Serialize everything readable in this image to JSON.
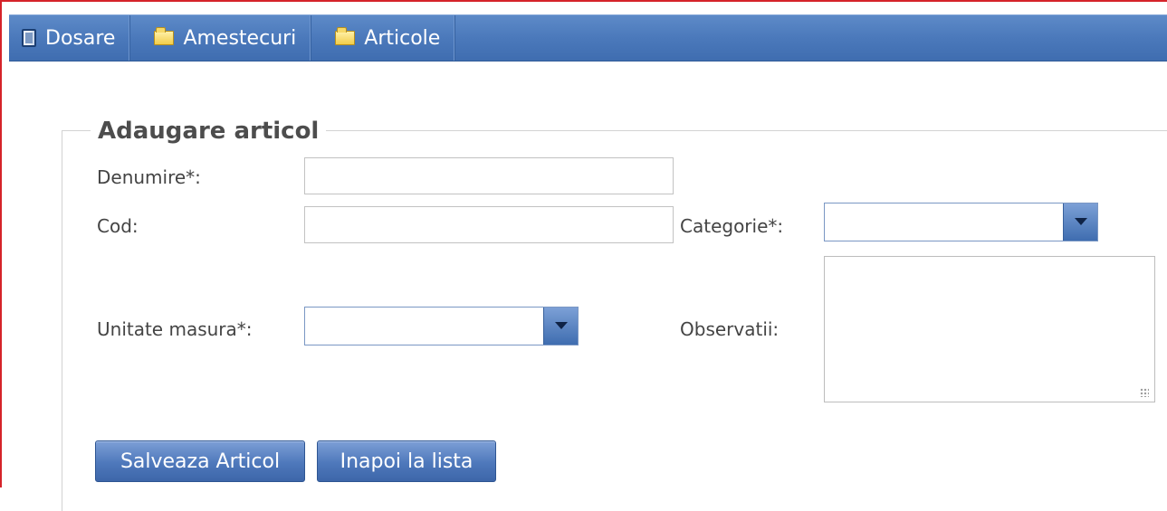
{
  "toolbar": {
    "items": [
      {
        "label": "Dosare",
        "icon": "book-icon"
      },
      {
        "label": "Amestecuri",
        "icon": "folder-icon"
      },
      {
        "label": "Articole",
        "icon": "folder-icon"
      }
    ]
  },
  "form": {
    "title": "Adaugare articol",
    "fields": {
      "denumire": {
        "label": "Denumire*:",
        "value": ""
      },
      "cod": {
        "label": "Cod:",
        "value": ""
      },
      "categorie": {
        "label": "Categorie*:",
        "value": ""
      },
      "unitate_masura": {
        "label": "Unitate masura*:",
        "value": ""
      },
      "observatii": {
        "label": "Observatii:",
        "value": ""
      }
    },
    "buttons": {
      "save": "Salveaza Articol",
      "back": "Inapoi la lista"
    }
  },
  "colors": {
    "frame_border": "#d5232a",
    "toolbar": "#4b79bb",
    "button": "#4e78bb"
  }
}
